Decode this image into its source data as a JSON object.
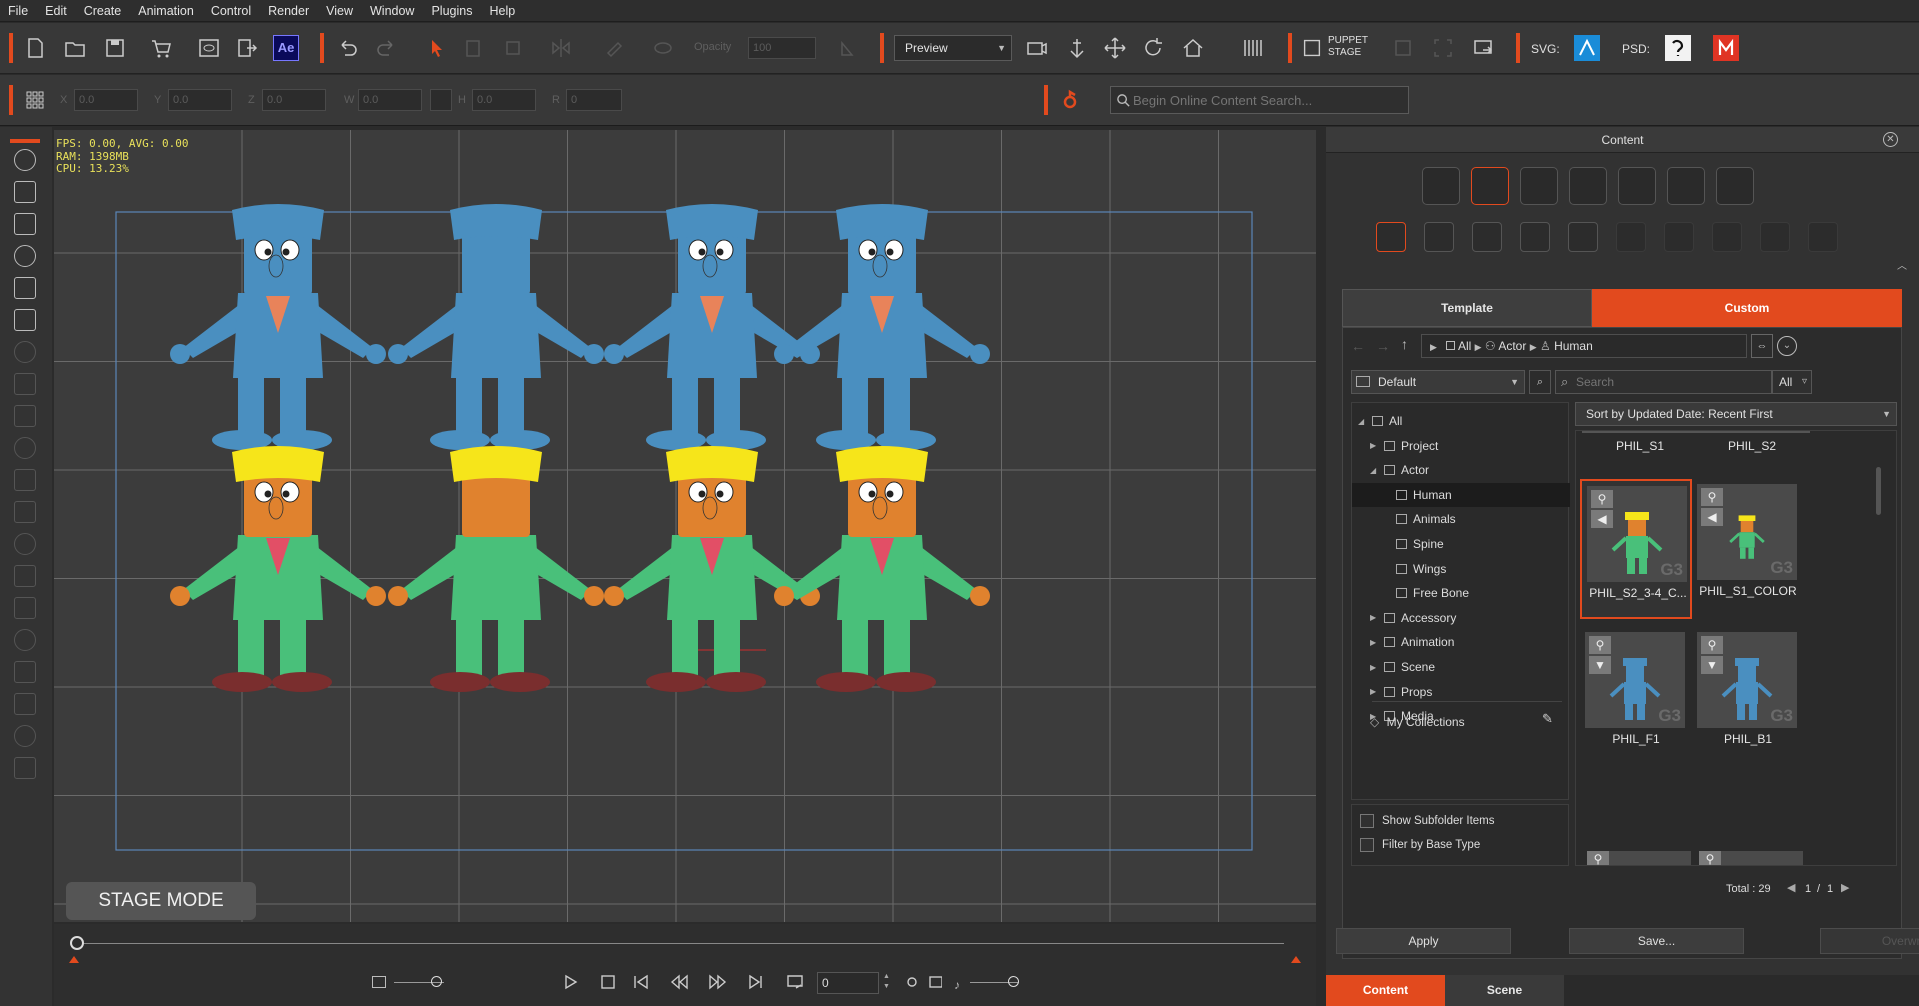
{
  "menu": [
    "File",
    "Edit",
    "Create",
    "Animation",
    "Control",
    "Render",
    "View",
    "Window",
    "Plugins",
    "Help"
  ],
  "toolbar": {
    "opacity_label": "Opacity",
    "opacity_value": "100",
    "view_mode": "Preview",
    "puppet_stage": "PUPPET\nSTAGE",
    "svg_label": "SVG:",
    "psd_label": "PSD:",
    "ae_label": "Ae"
  },
  "transform": {
    "x_label": "X",
    "x": "0.0",
    "y_label": "Y",
    "y": "0.0",
    "z_label": "Z",
    "z": "0.0",
    "w_label": "W",
    "w": "0.0",
    "h_label": "H",
    "h": "0.0",
    "r_label": "R",
    "r": "0"
  },
  "search": {
    "placeholder": "Begin Online Content Search..."
  },
  "stats": {
    "line1": "FPS: 0.00, AVG: 0.00",
    "line2": "RAM: 1398MB",
    "line3": "CPU: 13.23%"
  },
  "stage_mode": "STAGE MODE",
  "timeline": {
    "frame": "0"
  },
  "panel": {
    "title": "Content",
    "tabs": {
      "template": "Template",
      "custom": "Custom"
    },
    "breadcrumb": [
      "All",
      "Actor",
      "Human"
    ],
    "filter": "Default",
    "search_placeholder": "Search",
    "search_scope": "All",
    "sort": "Sort by Updated Date: Recent First",
    "tree": [
      {
        "label": "All",
        "indent": 0,
        "arrow": "down"
      },
      {
        "label": "Project",
        "indent": 1,
        "arrow": "right"
      },
      {
        "label": "Actor",
        "indent": 1,
        "arrow": "down"
      },
      {
        "label": "Human",
        "indent": 2,
        "arrow": "",
        "selected": true
      },
      {
        "label": "Animals",
        "indent": 2,
        "arrow": ""
      },
      {
        "label": "Spine",
        "indent": 2,
        "arrow": ""
      },
      {
        "label": "Wings",
        "indent": 2,
        "arrow": ""
      },
      {
        "label": "Free Bone",
        "indent": 2,
        "arrow": ""
      },
      {
        "label": "Accessory",
        "indent": 1,
        "arrow": "right"
      },
      {
        "label": "Animation",
        "indent": 1,
        "arrow": "right"
      },
      {
        "label": "Scene",
        "indent": 1,
        "arrow": "right"
      },
      {
        "label": "Props",
        "indent": 1,
        "arrow": "right"
      },
      {
        "label": "Media",
        "indent": 1,
        "arrow": "right"
      }
    ],
    "my_collections": "My Collections",
    "show_subfolder": "Show Subfolder Items",
    "filter_base": "Filter by Base Type",
    "top_labels": [
      "PHIL_S1",
      "PHIL_S2"
    ],
    "items": [
      {
        "label": "PHIL_S2_3-4_C...",
        "style": "green",
        "selected": true,
        "badge2": "◀"
      },
      {
        "label": "PHIL_S1_COLOR",
        "style": "green-small",
        "selected": false,
        "badge2": "◀"
      },
      {
        "label": "PHIL_F1",
        "style": "blue",
        "selected": false,
        "badge2": "▼"
      },
      {
        "label": "PHIL_B1",
        "style": "blue-back",
        "selected": false,
        "badge2": "▼"
      }
    ],
    "total": "Total : 29",
    "page": "1",
    "pages": "1",
    "apply": "Apply",
    "save": "Save...",
    "overwrite": "Overwrite",
    "bottom_tabs": {
      "content": "Content",
      "scene": "Scene"
    }
  },
  "colors": {
    "accent": "#e24a1e",
    "blue_char": "#4a8fc0",
    "green_suit": "#49c07a",
    "orange_skin": "#e0822e",
    "yellow_hair": "#f6e51a",
    "shoe": "#7a2e2e"
  }
}
